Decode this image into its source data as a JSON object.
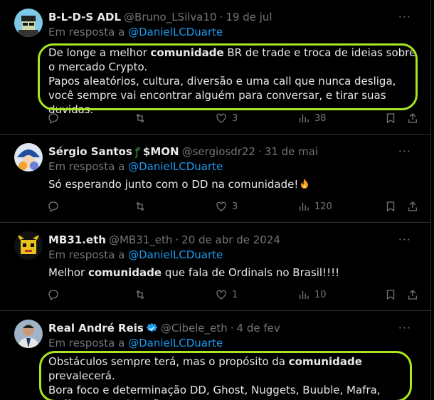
{
  "reply_prefix": "Em resposta a",
  "tweets": [
    {
      "name": "B-L-D-S ADL",
      "handle": "@Bruno_LSilva10",
      "date": "19 de jul",
      "reply_to": "@DanielLCDuarte",
      "text": {
        "p1": "De longe a melhor ",
        "bold": "comunidade",
        "p2": " BR de trade e troca de ideias sobre o mercado Crypto.",
        "p3": "Papos aleatórios, cultura, diversão e uma call que nunca desliga, você sempre vai encontrar alguém para conversar, e tirar suas duvidas."
      },
      "likes": "3",
      "views": "38"
    },
    {
      "name": "Sérgio Santos",
      "name_suffix": "$MON",
      "handle": "@sergiosdr22",
      "date": "31 de mai",
      "reply_to": "@DanielLCDuarte",
      "text": {
        "p1": "Só esperando junto com o DD na comunidade!"
      },
      "likes": "3",
      "views": "120"
    },
    {
      "name": "MB31.eth",
      "handle": "@MB31_eth",
      "date": "20 de abr de 2024",
      "reply_to": "@DanielLCDuarte",
      "text": {
        "p1": "Melhor ",
        "bold": "comunidade",
        "p2": " que fala de Ordinals no Brasil!!!!"
      },
      "likes": "1",
      "views": "10"
    },
    {
      "name": "Real André Reis",
      "handle": "@Cibele_eth",
      "date": "4 de fev",
      "reply_to": "@DanielLCDuarte",
      "text": {
        "p1": "Obstáculos sempre terá, mas o propósito da ",
        "bold": "comunidade",
        "p2": " prevalecerá.",
        "p3": "Bora foco e determinação DD, Ghost, Nuggets, Buuble, Mafra, Hoff e companhia não parem!"
      }
    }
  ],
  "colors": {
    "accent": "#1d9bf0",
    "highlight": "#a8e61d",
    "muted": "#71767b",
    "text": "#e7e9ea"
  },
  "icons": [
    "reply-icon",
    "retweet-icon",
    "like-icon",
    "views-icon",
    "bookmark-icon",
    "share-icon",
    "more-icon",
    "verified-icon",
    "fire-icon",
    "snake-icon"
  ]
}
